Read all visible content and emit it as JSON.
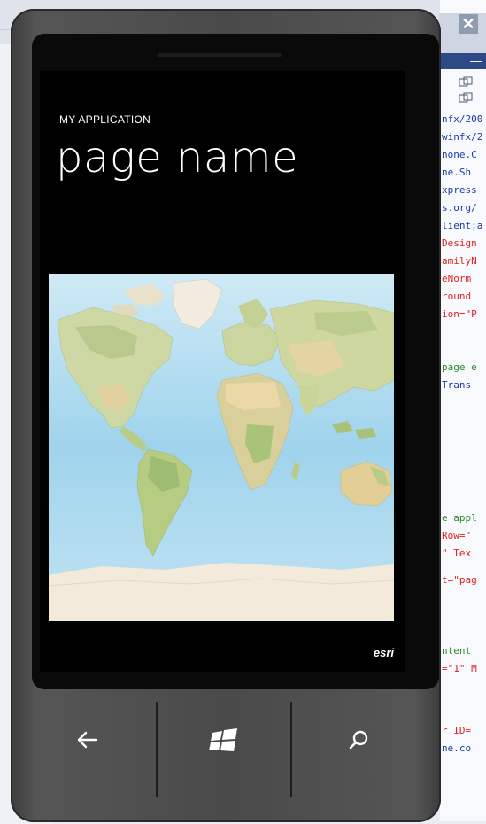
{
  "background_editor": {
    "close_glyph": "✕",
    "min_glyph": "—",
    "code_fragments": [
      {
        "text": "nfx/200",
        "color": "#1a3aa8"
      },
      {
        "text": "winfx/2",
        "color": "#1a3aa8"
      },
      {
        "text": "none.C",
        "color": "#1a3aa8"
      },
      {
        "text": "ne.Sh",
        "color": "#1a3aa8"
      },
      {
        "text": "xpress",
        "color": "#1a3aa8"
      },
      {
        "text": "s.org/",
        "color": "#1a3aa8"
      },
      {
        "text": "lient;a",
        "color": "#1a3aa8"
      },
      {
        "text": "Design",
        "color": "#d22"
      },
      {
        "text": "amilyN",
        "color": "#d22"
      },
      {
        "text": "eNorm",
        "color": "#d22"
      },
      {
        "text": "round",
        "color": "#d22"
      },
      {
        "text": "ion=\"P",
        "color": "#d22"
      },
      {
        "text": "page e",
        "color": "#2a8a2a"
      },
      {
        "text": "Trans",
        "color": "#1a3aa8"
      },
      {
        "text": "e appl",
        "color": "#2a8a2a"
      },
      {
        "text": "Row=\"",
        "color": "#d22"
      },
      {
        "text": "\" Tex",
        "color": "#d22"
      },
      {
        "text": "t=\"pag",
        "color": "#d22"
      },
      {
        "text": "ntent",
        "color": "#2a8a2a"
      },
      {
        "text": "=\"1\" M",
        "color": "#d22"
      },
      {
        "text": "r ID=",
        "color": "#d22"
      },
      {
        "text": "ne.co",
        "color": "#1a3aa8"
      }
    ]
  },
  "app": {
    "title": "MY APPLICATION",
    "page_name": "page name",
    "map_attribution": "esri"
  },
  "hardware_buttons": {
    "back": "back-icon",
    "start": "windows-logo-icon",
    "search": "search-icon"
  },
  "colors": {
    "screen_bg": "#000000",
    "text": "#ffffff",
    "ocean": "#bfe3f3",
    "land": "#c9d9a8"
  }
}
